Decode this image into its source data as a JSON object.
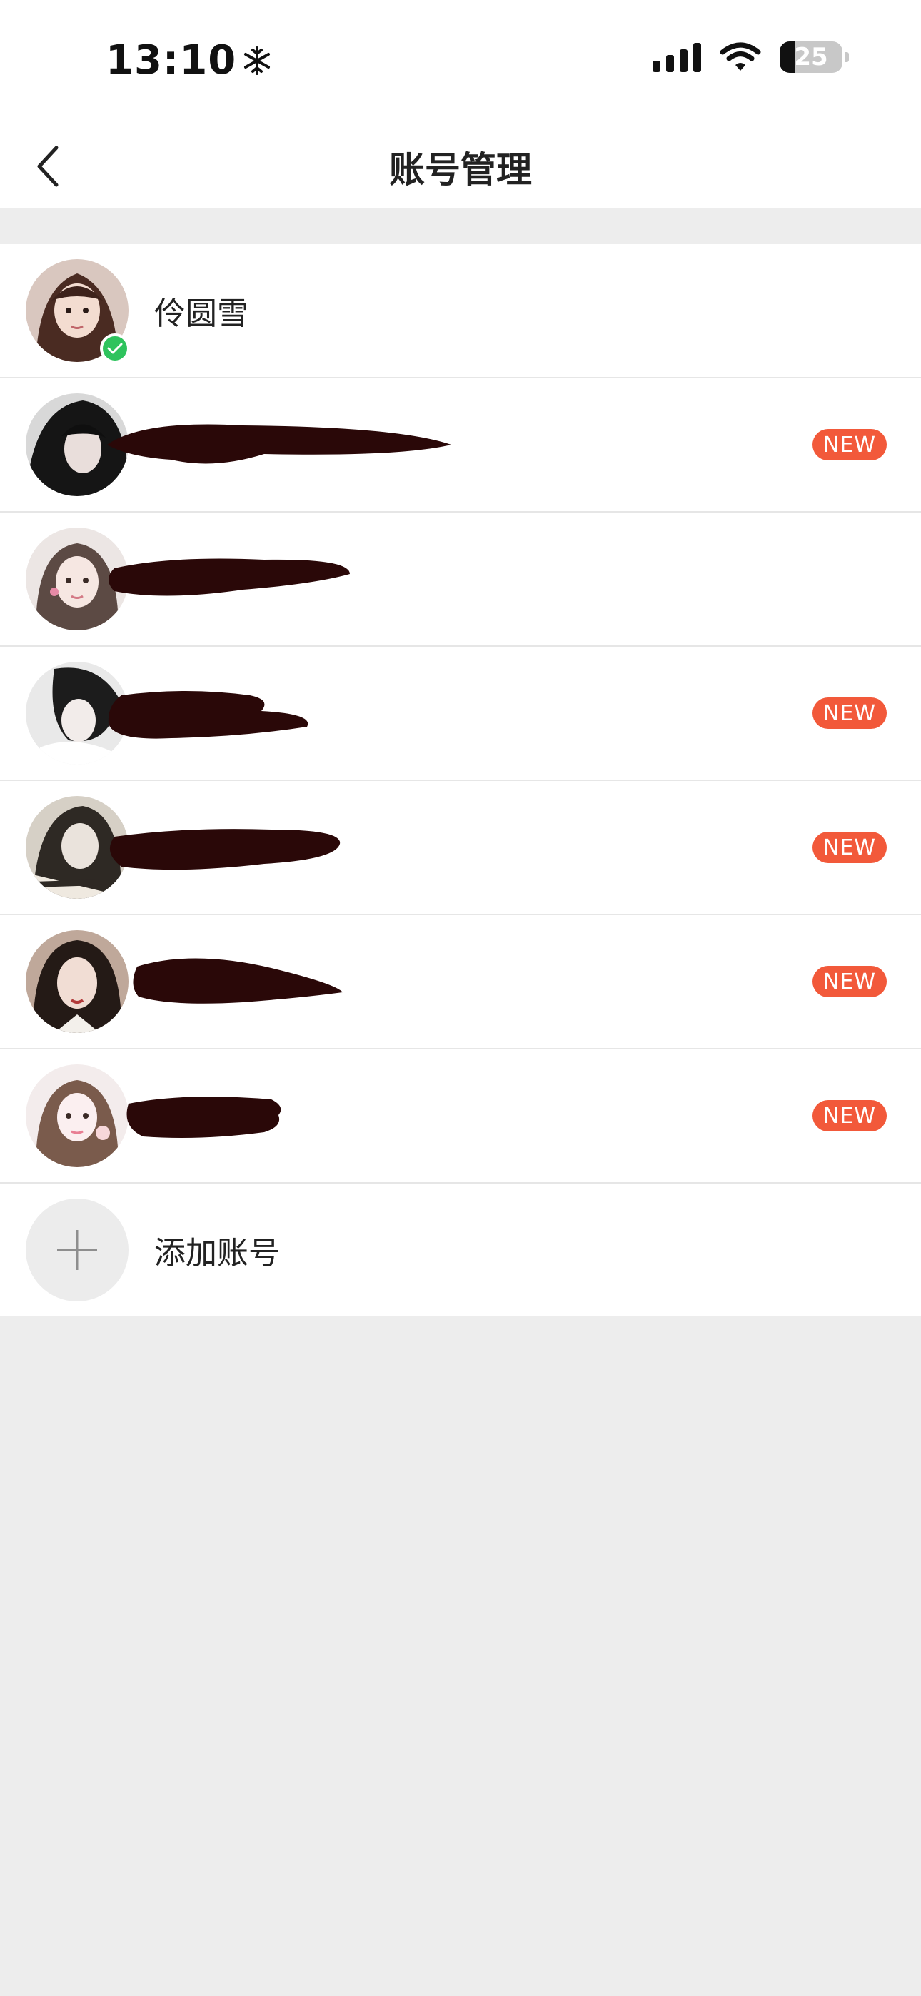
{
  "status_bar": {
    "time": "13:10",
    "battery": "25"
  },
  "nav": {
    "title": "账号管理"
  },
  "accounts": [
    {
      "name": "伶圆雪",
      "current": true,
      "new_badge": ""
    },
    {
      "name": "",
      "current": false,
      "new_badge": "NEW"
    },
    {
      "name": "",
      "current": false,
      "new_badge": ""
    },
    {
      "name": "",
      "current": false,
      "new_badge": "NEW"
    },
    {
      "name": "",
      "current": false,
      "new_badge": "NEW"
    },
    {
      "name": "",
      "current": false,
      "new_badge": "NEW"
    },
    {
      "name": "",
      "current": false,
      "new_badge": "NEW"
    }
  ],
  "add_account": {
    "label": "添加账号"
  },
  "colors": {
    "new_badge": "#f2593a",
    "check": "#2ec35d",
    "redaction": "#2a0808",
    "background": "#ededed"
  },
  "icons": [
    "snowflake-icon",
    "cellular-signal-icon",
    "wifi-icon",
    "battery-icon",
    "back-chevron-icon",
    "check-icon",
    "plus-icon"
  ]
}
